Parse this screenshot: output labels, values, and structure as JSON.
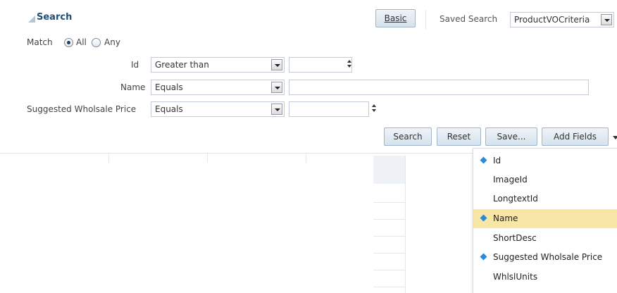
{
  "header": {
    "title": "Search",
    "basic_button": "Basic",
    "saved_search_label": "Saved Search",
    "saved_search_value": "ProductVOCriteria"
  },
  "match": {
    "label": "Match",
    "option_all": "All",
    "option_any": "Any",
    "selected": "All"
  },
  "fields": [
    {
      "label": "Id",
      "operator": "Greater than",
      "value": ""
    },
    {
      "label": "Name",
      "operator": "Equals",
      "value": ""
    },
    {
      "label": "Suggested Wholsale Price",
      "operator": "Equals",
      "value": ""
    }
  ],
  "actions": {
    "search": "Search",
    "reset": "Reset",
    "save": "Save...",
    "add_fields": "Add Fields"
  },
  "add_fields_menu": {
    "items": [
      {
        "label": "Id",
        "selected": true,
        "highlighted": false
      },
      {
        "label": "ImageId",
        "selected": false,
        "highlighted": false
      },
      {
        "label": "LongtextId",
        "selected": false,
        "highlighted": false
      },
      {
        "label": "Name",
        "selected": true,
        "highlighted": true
      },
      {
        "label": "ShortDesc",
        "selected": false,
        "highlighted": false
      },
      {
        "label": "Suggested Wholsale Price",
        "selected": true,
        "highlighted": false
      },
      {
        "label": "WhlslUnits",
        "selected": false,
        "highlighted": false
      }
    ],
    "highlight_color": "#f8e6a6",
    "marker_color": "#2b8ad8"
  }
}
